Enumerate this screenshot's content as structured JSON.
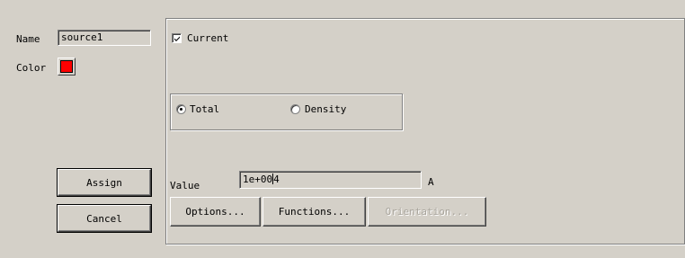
{
  "left_panel": {
    "name_label": "Name",
    "name_value": "source1",
    "color_label": "Color",
    "color_value": "#ff0000",
    "assign_label": "Assign",
    "cancel_label": "Cancel"
  },
  "right_panel": {
    "current_label": "Current",
    "current_checked": true,
    "radio_total_label": "Total",
    "radio_density_label": "Density",
    "radio_selected": "Total",
    "value_label": "Value",
    "value_text_before_caret": "1e+00",
    "value_text_after_caret": "4",
    "unit_label": "A",
    "options_label": "Options...",
    "functions_label": "Functions...",
    "orientation_label": "Orientation..."
  },
  "icons": {
    "checkbox": "checkmark-icon",
    "radio": "radio-dot-icon",
    "color": "color-swatch-icon"
  }
}
